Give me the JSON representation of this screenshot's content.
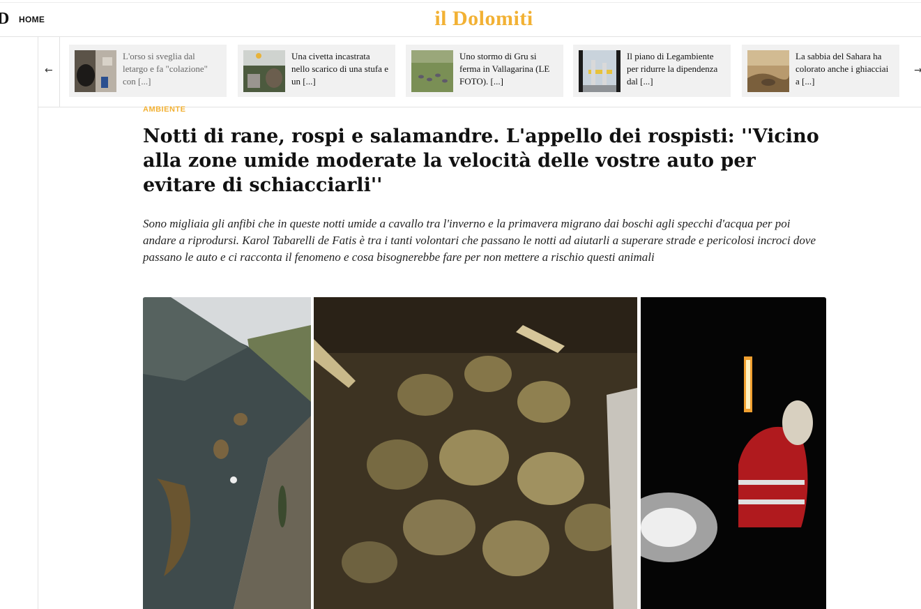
{
  "header": {
    "logo_mark": "D",
    "nav_home": "HOME",
    "brand": "il Dolomiti",
    "brand_color": "#f2b134"
  },
  "ticker": {
    "prev_icon": "arrow-left-icon",
    "next_icon": "arrow-right-icon",
    "items": [
      {
        "text": "L'orso si sveglia dal letargo e fa \"colazione\" con [...]"
      },
      {
        "text": "Una civetta incastrata nello scarico di una stufa e un [...]"
      },
      {
        "text": "Uno stormo di Gru si ferma in Vallagarina (LE FOTO). [...]"
      },
      {
        "text": "Il piano di Legambiente per ridurre la dipendenza dal [...]"
      },
      {
        "text": "La sabbia del Sahara ha colorato anche i ghiacciai a [...]"
      }
    ]
  },
  "article": {
    "category": "AMBIENTE",
    "title": "Notti di rane, rospi e salamandre. L'appello dei rospisti: ''Vicino alla zone umide moderate la velocità delle vostre auto per evitare di schiacciarli''",
    "lead": "Sono migliaia gli anfibi che in queste notti umide a cavallo tra l'inverno e la primavera migrano dai boschi agli specchi d'acqua per poi andare a riprodursi. Karol Tabarelli de Fatis è tra i tanti volontari che passano le notti ad aiutarli a superare strade e pericolosi incroci dove passano le auto e ci racconta il fenomeno e cosa bisognerebbe fare per non mettere a rischio questi animali"
  }
}
